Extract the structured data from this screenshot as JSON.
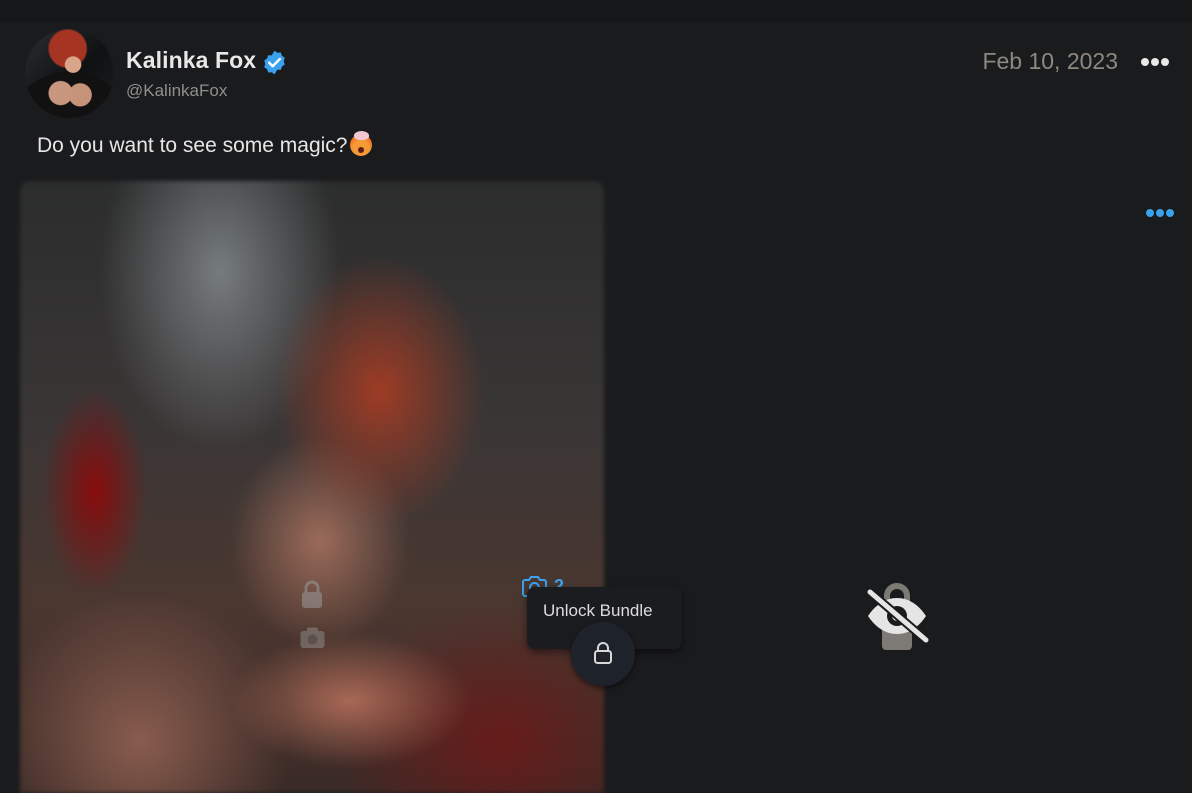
{
  "post": {
    "author": {
      "name": "Kalinka Fox",
      "handle": "@KalinkaFox",
      "verified": true
    },
    "date": "Feb 10, 2023",
    "text": "Do you want to see some magic?",
    "emoji": "exploding-head-emoji",
    "media": {
      "locked": true,
      "photo_count": "2",
      "unlock_label": "Unlock Bundle"
    }
  },
  "colors": {
    "background": "#1a1b1d",
    "accent": "#3aa1ee",
    "muted": "#8f8f8f",
    "date": "#8d8880"
  },
  "icons": {
    "verified": "verified-badge-icon",
    "more": "more-options-icon",
    "lock": "lock-icon",
    "camera": "camera-icon",
    "hidden": "eye-off-icon"
  }
}
